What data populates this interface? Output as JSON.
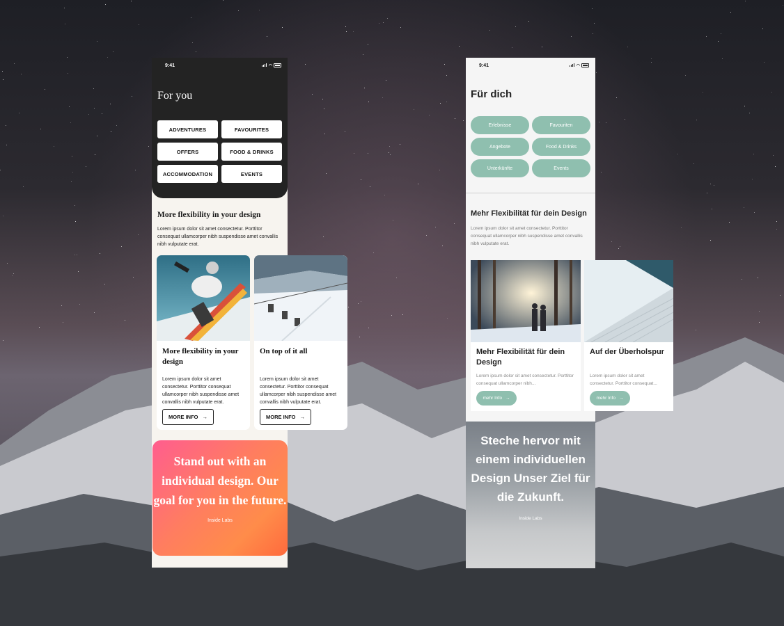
{
  "phone_a": {
    "status_time": "9:41",
    "title": "For you",
    "categories": [
      "ADVENTURES",
      "FAVOURITES",
      "OFFERS",
      "FOOD & DRINKS",
      "ACCOMMODATION",
      "EVENTS"
    ],
    "section_title": "More flexibility in your design",
    "section_text": "Lorem ipsum dolor sit amet consectetur. Porttitor consequat ullamcorper nibh suspendisse amet convallis nibh vulputate erat.",
    "cards": [
      {
        "title": "More flexibility in your design",
        "text": "Lorem ipsum dolor sit amet consectetur. Porttitor consequat ullamcorper nibh suspendisse amet convallis nibh vulputate erat.",
        "button": "MORE INFO"
      },
      {
        "title": "On top of it all",
        "text": "Lorem ipsum dolor sit amet consectetur. Porttitor consequat ullamcorper nibh suspendisse amet convallis nibh vulputate erat.",
        "button": "MORE INFO"
      }
    ],
    "promo_text": "Stand out with an individual design. Our goal for you in the future.",
    "promo_caption": "Inside Labs",
    "arrow_icon": "→"
  },
  "phone_b": {
    "status_time": "9:41",
    "title": "Für dich",
    "categories": [
      "Erlebnisse",
      "Favouriten",
      "Angebote",
      "Food & Drinks",
      "Unterkünfte",
      "Events"
    ],
    "section_title": "Mehr Flexibilität für dein Design",
    "section_text": "Lorem ipsum dolor sit amet consectetur. Porttitor consequat ullamcorper nibh suspendisse amet convallis nibh vulputate erat.",
    "cards": [
      {
        "title": "Mehr Flexibilität für dein Design",
        "text": "Lorem ipsum dolor sit amet consectetur. Porttitor consequat ullamcorper nibh...",
        "button": "mehr Info"
      },
      {
        "title": "Auf der Überholspur",
        "text": "Lorem ipsum dolor sit amet consectetur. Porttitor consequat...",
        "button": "mehr Info"
      }
    ],
    "promo_text": "Steche hervor mit einem individuellen Design Unser Ziel für die Zukunft.",
    "promo_caption": "Inside Labs",
    "arrow_icon": "→"
  },
  "colors": {
    "accent_green": "#8fbfaf",
    "dark_header": "#232323",
    "promo_gradient_start": "#ff5d8f",
    "promo_gradient_end": "#ff6a3d"
  }
}
